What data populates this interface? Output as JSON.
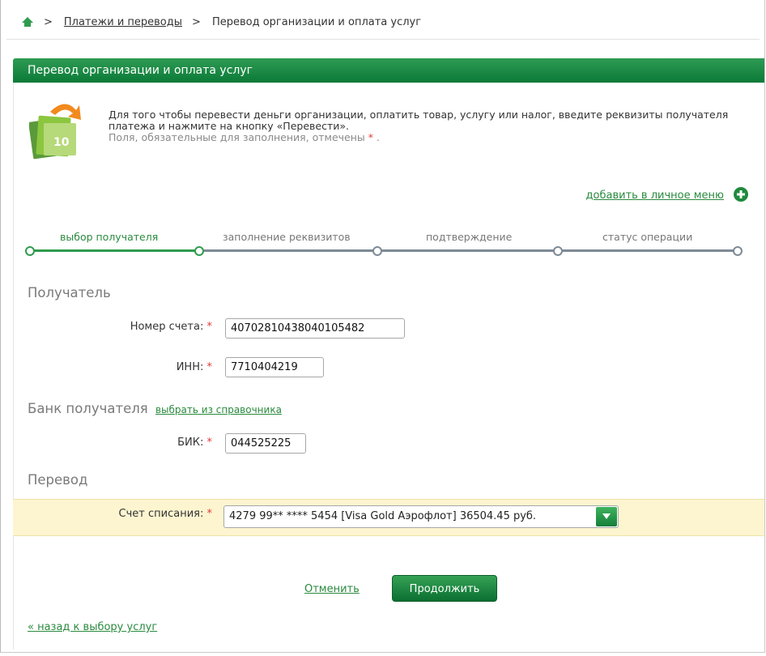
{
  "breadcrumb": {
    "items": [
      "Платежи и переводы",
      "Перевод организации и оплата услуг"
    ]
  },
  "header": {
    "title": "Перевод организации и оплата услуг"
  },
  "intro": {
    "text": "Для того чтобы перевести деньги организации, оплатить товар, услугу или налог, введите реквизиты получателя платежа и нажмите на кнопку «Перевести».",
    "hint": "Поля, обязательные для заполнения, отмечены",
    "hint_star": "*",
    "hint_end": "."
  },
  "add_menu": {
    "label": "добавить в личное меню"
  },
  "steps": [
    {
      "label": "выбор получателя",
      "active": true
    },
    {
      "label": "заполнение реквизитов",
      "active": false
    },
    {
      "label": "подтверждение",
      "active": false
    },
    {
      "label": "статус операции",
      "active": false
    }
  ],
  "recipient": {
    "title": "Получатель",
    "account_label": "Номер счета:",
    "account_value": "40702810438040105482",
    "inn_label": "ИНН:",
    "inn_value": "7710404219"
  },
  "bank": {
    "title": "Банк получателя",
    "dict_link": "выбрать из справочника",
    "bik_label": "БИК:",
    "bik_value": "044525225"
  },
  "transfer": {
    "title": "Перевод",
    "account_label": "Счет списания:",
    "account_selected": "4279 99** **** 5454 [Visa Gold Аэрофлот] 36504.45 руб."
  },
  "required_star": "*",
  "actions": {
    "cancel": "Отменить",
    "continue": "Продолжить"
  },
  "back": {
    "label": "« назад к выбору услуг"
  },
  "colors": {
    "brand_green": "#0b7a38",
    "link_green": "#2a8a3e",
    "highlight_yellow": "#fdf5d0",
    "required_red": "#e03a3a"
  }
}
